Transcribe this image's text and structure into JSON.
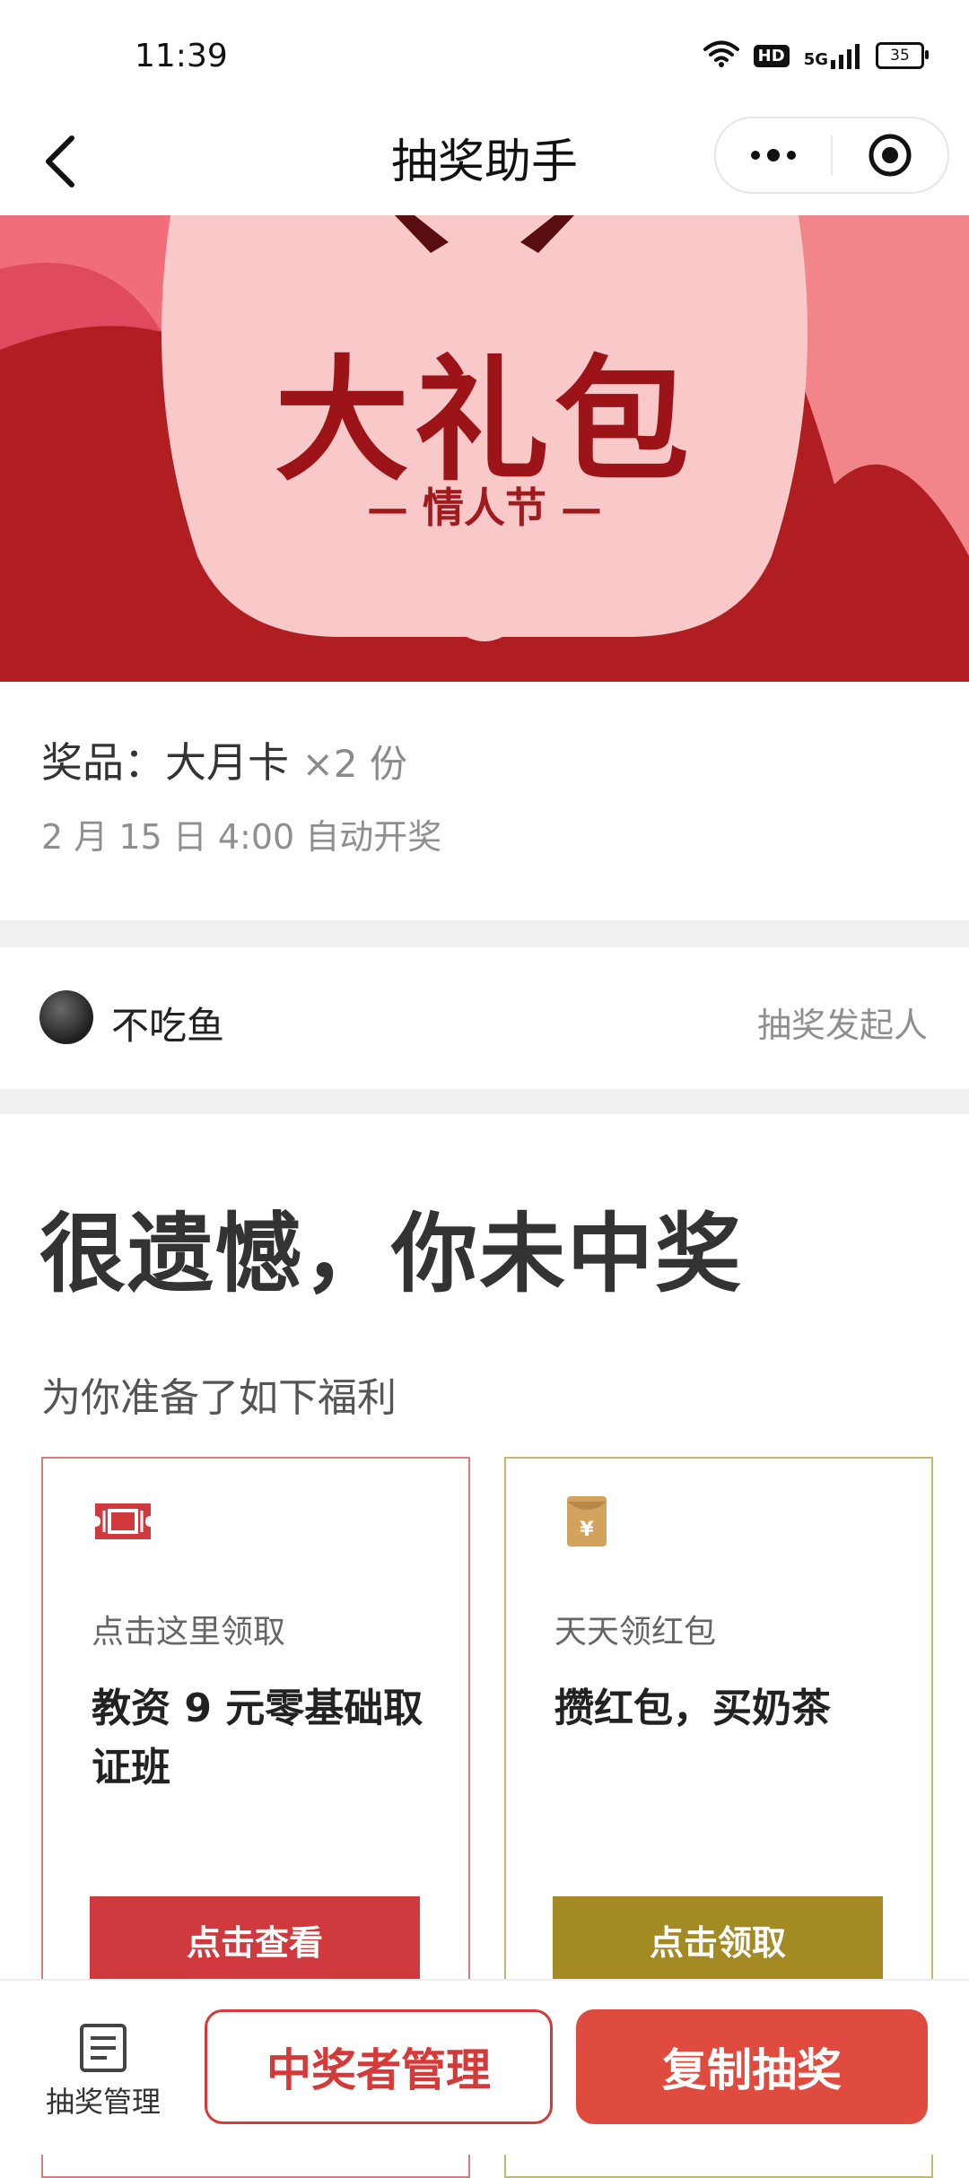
{
  "status_bar": {
    "time": "11:39",
    "hd_label": "HD",
    "signal_label": "5G",
    "battery": "35"
  },
  "nav": {
    "title": "抽奖助手"
  },
  "banner": {
    "title": "大礼包",
    "subtitle": "— 情人节 —"
  },
  "prize": {
    "label": "奖品：",
    "name": "大月卡",
    "quantity": "×2 份",
    "draw_time": "2 月 15 日 4:00 自动开奖"
  },
  "sponsor": {
    "name": "不吃鱼",
    "role": "抽奖发起人"
  },
  "result": {
    "title": "很遗憾，你未中奖",
    "welfare_text": "为你准备了如下福利"
  },
  "cards": [
    {
      "subtitle": "点击这里领取",
      "title": "教资 9 元零基础取证班",
      "button": "点击查看",
      "accent": "#d0393d",
      "icon": "ticket-icon"
    },
    {
      "subtitle": "天天领红包",
      "title": "攒红包，买奶茶",
      "button": "点击领取",
      "accent": "#a38a23",
      "icon": "red-envelope-icon"
    }
  ],
  "bottom_bar": {
    "manage_label": "抽奖管理",
    "winners_button": "中奖者管理",
    "copy_button": "复制抽奖"
  },
  "colors": {
    "brand_red": "#e04b40",
    "banner_red": "#b01e22",
    "banner_pink": "#f9c9c9"
  }
}
